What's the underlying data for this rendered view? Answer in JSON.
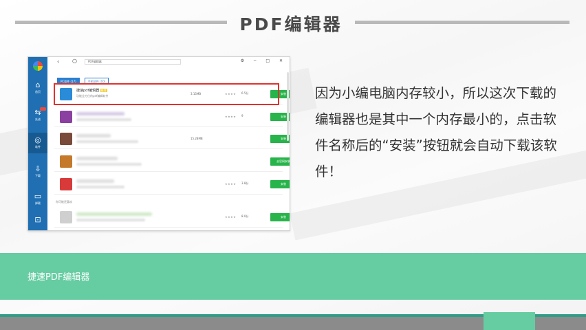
{
  "slide": {
    "title": "PDF编辑器",
    "watermark": "",
    "description": "因为小编电脑内存较小，所以这次下载的编辑器也是其中一个内存最小的，点击软件名称后的“安装”按钮就会自动下载该软件！",
    "caption": "捷速PDF编辑器"
  },
  "screenshot": {
    "address": "PDF编辑器",
    "window_controls": "⚙ ─ □ ✕",
    "tabs": [
      {
        "label": "PC软件 (17)",
        "active": true
      },
      {
        "label": "手机软件 (10)",
        "active": false
      }
    ],
    "sidebar": [
      {
        "icon": "⌂",
        "label": "首页"
      },
      {
        "icon": "⇆",
        "label": "先进"
      },
      {
        "icon": "◎",
        "label": "软件"
      },
      {
        "icon": "⇩",
        "label": "下载"
      },
      {
        "icon": "▭",
        "label": "卸载"
      },
      {
        "icon": "⊡",
        "label": ""
      }
    ],
    "rows": [
      {
        "name": "捷速pdf编辑器",
        "tag": "推荐",
        "desc": "功能全方位的pdf编辑软件",
        "size": "3.15MB",
        "stars": "★★★★",
        "score": "6.5分",
        "button": "安装",
        "icon_color": "#2a8bd8",
        "blurred": false
      },
      {
        "name": "",
        "tag": "",
        "desc": "",
        "size": "",
        "stars": "★★★★",
        "score": "9",
        "button": "安装",
        "icon_color": "#8b3fa0",
        "blurred": true
      },
      {
        "name": "",
        "tag": "",
        "desc": "",
        "size": "15.28MB",
        "stars": "",
        "score": "",
        "button": "安装",
        "icon_color": "#7a4a3a",
        "blurred": true
      },
      {
        "name": "",
        "tag": "",
        "desc": "",
        "size": "",
        "stars": "",
        "score": "",
        "button": "去官网安装",
        "icon_color": "#c47a2a",
        "blurred": true
      },
      {
        "name": "",
        "tag": "",
        "desc": "",
        "size": "",
        "stars": "★★★★",
        "score": "3.8分",
        "button": "安装",
        "icon_color": "#d83a3a",
        "blurred": true
      },
      {
        "name": "",
        "tag": "",
        "desc": "",
        "size": "",
        "stars": "★★★★",
        "score": "8.0分",
        "button": "安装",
        "icon_color": "#cfcfcf",
        "blurred": true
      }
    ],
    "section_label": "你可能还喜欢"
  },
  "colors": {
    "band": "#66cca2",
    "highlight": "#e0312c",
    "install_button": "#27b44a",
    "sidebar": "#1f6fb2"
  }
}
